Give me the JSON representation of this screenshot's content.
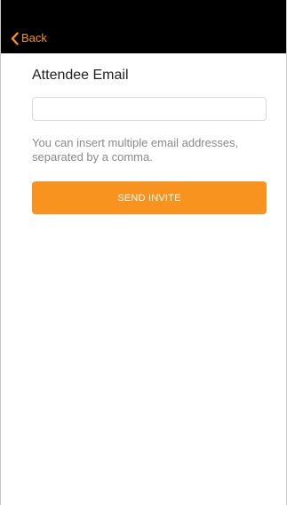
{
  "nav": {
    "back_label": "Back"
  },
  "form": {
    "title": "Attendee Email",
    "email_value": "",
    "email_placeholder": "",
    "helper_text": "You can insert multiple email addresses, separated by a comma.",
    "send_label": "SEND INVITE"
  },
  "colors": {
    "accent": "#f7931e",
    "nav_background": "#000000"
  },
  "icons": {
    "back": "chevron-left-icon"
  }
}
